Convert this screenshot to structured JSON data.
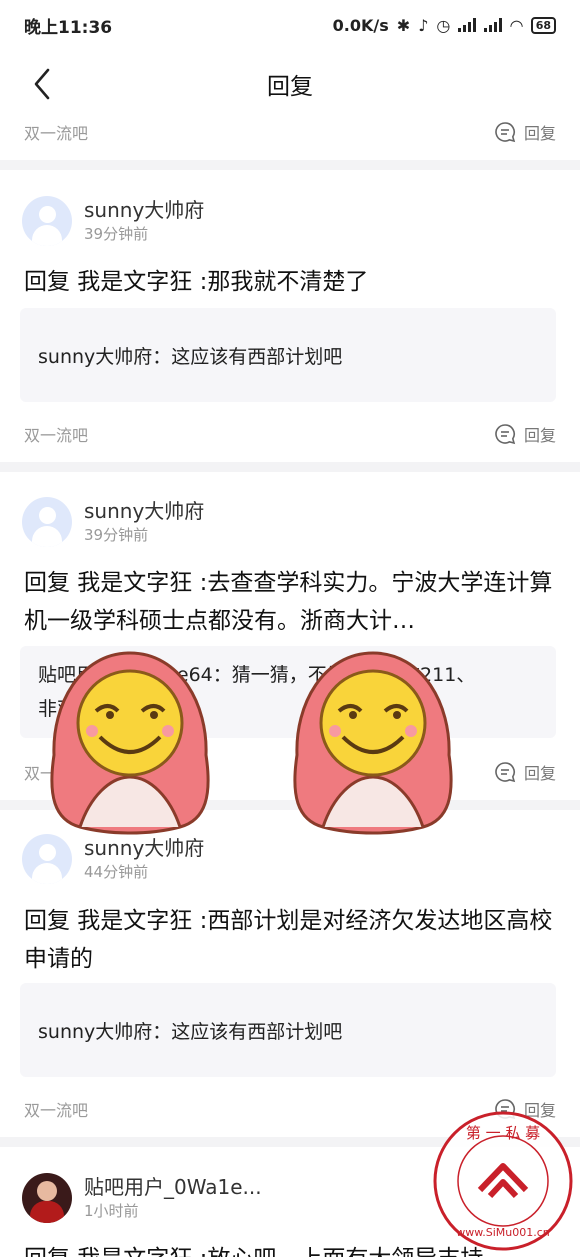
{
  "status_bar": {
    "time": "晚上11:36",
    "speed": "0.0K/s",
    "battery": "68"
  },
  "nav": {
    "title": "回复"
  },
  "top_footer": {
    "tag": "双一流吧",
    "reply_label": "回复"
  },
  "posts": [
    {
      "username": "sunny大帅府",
      "time": "39分钟前",
      "content": "回复 我是文字狂 :那我就不清楚了",
      "quote": "sunny大帅府：这应该有西部计划吧",
      "tag": "双一流吧",
      "reply_label": "回复"
    },
    {
      "username": "sunny大帅府",
      "time": "39分钟前",
      "content": "回复 我是文字狂 :去查查学科实力。宁波大学连计算机一级学科硕士点都没有。浙商大计…",
      "quote_line1": "贴吧用户_0Wa1e64：猜一猜，不是985、非211、",
      "quote_line2": "非双一流",
      "tag": "双一流吧",
      "reply_label": "回复"
    },
    {
      "username": "sunny大帅府",
      "time": "44分钟前",
      "content": "回复 我是文字狂 :西部计划是对经济欠发达地区高校申请的",
      "quote": "sunny大帅府：这应该有西部计划吧",
      "tag": "双一流吧",
      "reply_label": "回复"
    },
    {
      "username": "贴吧用户_0Wa1e...",
      "time": "1小时前",
      "content": "回复 我是文字狂 :放心吧，上面有大领导支持"
    }
  ],
  "watermark": {
    "top_text": "第一私募",
    "bottom_text": "www.SiMu001.cn"
  },
  "colors": {
    "accent": "#c9202a",
    "separator": "#f3f3f5",
    "quote_bg": "#f6f6f9",
    "muted": "#9a9a9a"
  }
}
